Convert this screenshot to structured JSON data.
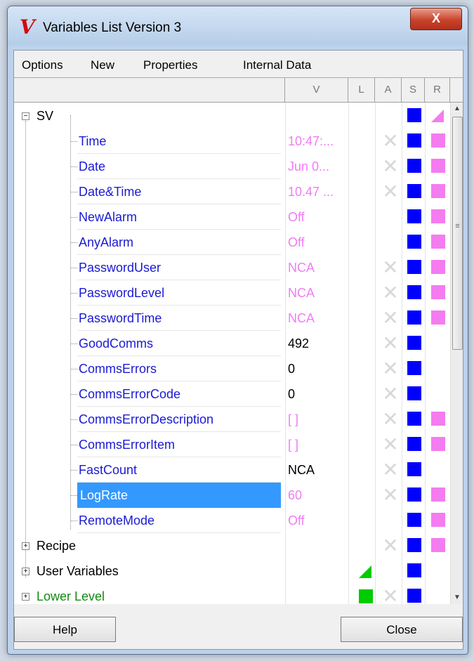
{
  "window": {
    "title": "Variables List Version 3",
    "close_glyph": "X",
    "app_icon": "V"
  },
  "menu": [
    "Options",
    "New",
    "Properties",
    "Internal Data"
  ],
  "columns": {
    "v": "V",
    "l": "L",
    "a": "A",
    "s": "S",
    "r": "R"
  },
  "rows": [
    {
      "name": "SV",
      "value": ""
    },
    {
      "name": "Time",
      "value": "10:47:..."
    },
    {
      "name": "Date",
      "value": "Jun 0..."
    },
    {
      "name": "Date&Time",
      "value": "10.47 ..."
    },
    {
      "name": "NewAlarm",
      "value": "Off"
    },
    {
      "name": "AnyAlarm",
      "value": "Off"
    },
    {
      "name": "PasswordUser",
      "value": "NCA"
    },
    {
      "name": "PasswordLevel",
      "value": "NCA"
    },
    {
      "name": "PasswordTime",
      "value": "NCA"
    },
    {
      "name": "GoodComms",
      "value": "492"
    },
    {
      "name": "CommsErrors",
      "value": "0"
    },
    {
      "name": "CommsErrorCode",
      "value": "0"
    },
    {
      "name": "CommsErrorDescription",
      "value": "[ ]"
    },
    {
      "name": "CommsErrorItem",
      "value": "[ ]"
    },
    {
      "name": "FastCount",
      "value": "NCA"
    },
    {
      "name": "LogRate",
      "value": "60"
    },
    {
      "name": "RemoteMode",
      "value": "Off"
    },
    {
      "name": "Recipe",
      "value": ""
    },
    {
      "name": "User Variables",
      "value": ""
    },
    {
      "name": "Lower Level",
      "value": ""
    }
  ],
  "colors": {
    "blue": "#0000ff",
    "pink": "#f47cf0",
    "green": "#00cc00",
    "selection": "#3399ff"
  },
  "footer": {
    "help_label": "Help",
    "close_label": "Close"
  }
}
